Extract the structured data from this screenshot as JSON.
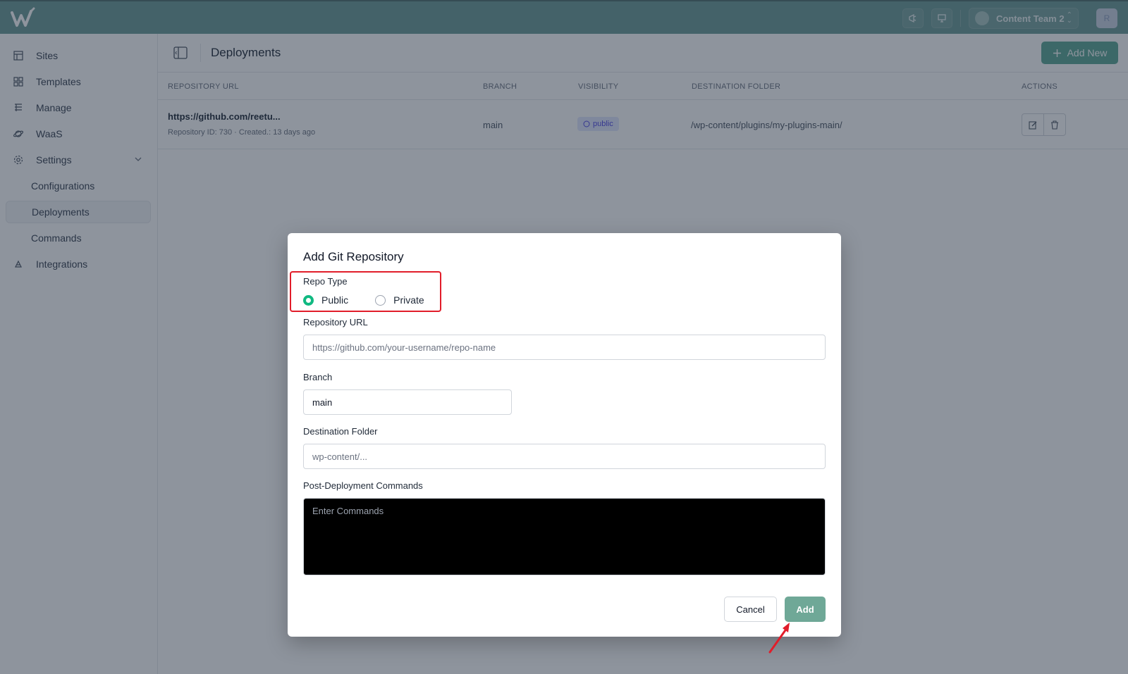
{
  "topbar": {
    "team_name": "Content Team 2",
    "user_initial": "R"
  },
  "sidebar": {
    "items": [
      {
        "label": "Sites",
        "icon": "layout-icon"
      },
      {
        "label": "Templates",
        "icon": "grid-icon"
      },
      {
        "label": "Manage",
        "icon": "server-icon"
      },
      {
        "label": "WaaS",
        "icon": "planet-icon"
      },
      {
        "label": "Settings",
        "icon": "gear-icon"
      }
    ],
    "settings_sub": [
      {
        "label": "Configurations"
      },
      {
        "label": "Deployments"
      },
      {
        "label": "Commands"
      }
    ],
    "integrations": {
      "label": "Integrations",
      "icon": "integrations-icon"
    }
  },
  "header": {
    "title": "Deployments",
    "add_new_label": "Add New"
  },
  "table": {
    "columns": [
      "Repository URL",
      "Branch",
      "Visibility",
      "Destination Folder",
      "Actions"
    ],
    "rows": [
      {
        "repo_url": "https://github.com/reetu...",
        "repo_id": "Repository ID: 730",
        "created": "Created.: 13 days ago",
        "branch": "main",
        "visibility": "public",
        "destination": "/wp-content/plugins/my-plugins-main/"
      }
    ]
  },
  "modal": {
    "title": "Add Git Repository",
    "repo_type_label": "Repo Type",
    "public_label": "Public",
    "private_label": "Private",
    "selected_repo_type": "Public",
    "repo_url_label": "Repository URL",
    "repo_url_placeholder": "https://github.com/your-username/repo-name",
    "branch_label": "Branch",
    "branch_value": "main",
    "dest_label": "Destination Folder",
    "dest_placeholder": "wp-content/...",
    "commands_label": "Post-Deployment Commands",
    "commands_placeholder": "Enter Commands",
    "cancel_label": "Cancel",
    "add_label": "Add"
  },
  "colors": {
    "brand": "#6b9a96",
    "accent": "#5aa794",
    "radio_checked": "#10b981",
    "highlight": "#e11d2a"
  }
}
